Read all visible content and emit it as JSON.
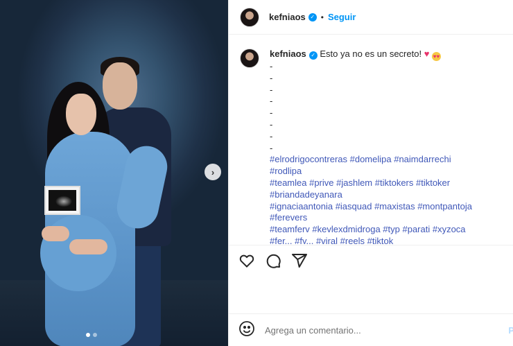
{
  "post": {
    "author": "kefniaos",
    "follow_label": "Seguir",
    "separator": "•",
    "caption_text": "Esto ya no es un secreto!",
    "caption_dashes": [
      "-",
      "-",
      "-",
      "-",
      "-",
      "-",
      "-",
      "-"
    ],
    "hashtag_lines": [
      "#elrodrigocontreras #domelipa #naimdarrechi",
      "#rodlipa",
      "#teamlea #prive #jashlem #tiktokers #tiktoker",
      "#briandadeyanara",
      "#ignaciaantonia #iasquad #maxistas #montpantoja",
      "#ferevers",
      "#teamferv #kevlexdmidroga #typ #parati #xyzoca",
      "#fer... #fy... #viral #reels #tiktok"
    ]
  },
  "actions": {
    "icons": [
      "heart-icon",
      "comment-icon",
      "share-icon"
    ]
  },
  "comment": {
    "placeholder": "Agrega un comentario...",
    "post_label": "P"
  },
  "carousel": {
    "next_glyph": "›",
    "slide_count": 2,
    "active_index": 0
  },
  "colors": {
    "accent": "#0095f6",
    "hashtag": "#4058b8",
    "heart": "#e8336b"
  }
}
